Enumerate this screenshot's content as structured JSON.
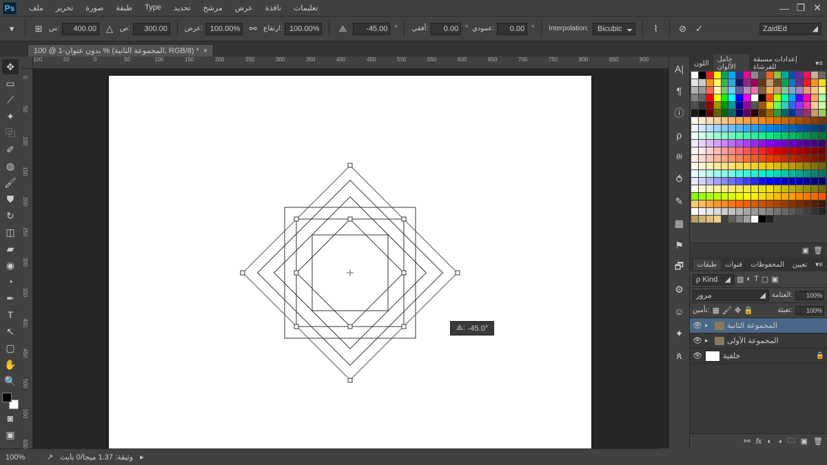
{
  "menu": [
    "ملف",
    "تحرير",
    "صورة",
    "طبقة",
    "Type",
    "تحديد",
    "مرشح",
    "عرض",
    "نافذة",
    "تعليمات"
  ],
  "optionbar": {
    "x_lbl": "س:",
    "x": "400.00",
    "y_lbl": "ص:",
    "y": "300.00",
    "w_lbl": "عرض:",
    "w": "100.00%",
    "h_lbl": "ارتفاع:",
    "h": "100.00%",
    "angle": "-45.00",
    "hskew_lbl": "أفقي:",
    "hskew": "0.00",
    "vskew_lbl": "عمودي:",
    "vskew": "0.00",
    "interp_lbl": "Interpolation:",
    "interp": "Bicubic",
    "workspace": "ZaidEd"
  },
  "doc_tab": "بدون عنوان-1 @ 100 % (المجموعة الثانية, RGB/8) *",
  "hruler_ticks": [
    "100",
    "50",
    "0",
    "50",
    "100",
    "150",
    "200",
    "250",
    "300",
    "350",
    "400",
    "450",
    "500",
    "550",
    "600",
    "650",
    "700",
    "750",
    "800",
    "850",
    "900"
  ],
  "vruler_ticks": [
    "0",
    "50",
    "100",
    "150",
    "200",
    "250",
    "300",
    "350",
    "400",
    "450",
    "500",
    "550",
    "600"
  ],
  "rotation_tooltip": "-45.0°",
  "panels": {
    "tabs_top": [
      "اللون",
      "حامل الألوان",
      "إعدادات مسبقة للفرشاة"
    ],
    "tabs_layers": [
      "طبقات",
      "قنوات",
      "المحفوظات",
      "تعيين"
    ],
    "kind": "ρ Kind",
    "blend": "مرور",
    "opacity_lbl": "العتامة:",
    "opacity": "100%",
    "fill_lbl": "تعبئة:",
    "fill": "100%",
    "lock_lbl": "تأمين:"
  },
  "layers": [
    {
      "name": "المجموعة الثانية",
      "type": "group",
      "sel": true
    },
    {
      "name": "المجموعة الأولى",
      "type": "group",
      "sel": false
    },
    {
      "name": "خلفية",
      "type": "bg",
      "sel": false
    }
  ],
  "status": {
    "zoom": "100%",
    "doc": "وثيقة: 1.37 ميجا/0 بايت"
  },
  "swatch_colors": [
    "#ffffff",
    "#000000",
    "#ec1c24",
    "#fff200",
    "#00a651",
    "#00aeef",
    "#2e3192",
    "#ec008c",
    "#898989",
    "#4d4d4d",
    "#f26522",
    "#8dc63f",
    "#00a99d",
    "#0054a6",
    "#662d91",
    "#ed145b",
    "#c7b299",
    "#736357",
    "#e6e6e6",
    "#cccccc",
    "#f7941d",
    "#fff568",
    "#39b54a",
    "#27aae1",
    "#1b1464",
    "#92278f",
    "#9e005d",
    "#603913",
    "#c49a6c",
    "#754c24",
    "#00a651",
    "#1c75bc",
    "#662d91",
    "#ed1c24",
    "#f7941d",
    "#ffde17",
    "#b3b3b3",
    "#999999",
    "#f26c4f",
    "#fff9ae",
    "#7cc576",
    "#6dcff6",
    "#605ca8",
    "#bd8cbf",
    "#f06eaa",
    "#8b5e3c",
    "#fbaf5d",
    "#c69c6d",
    "#82ca9c",
    "#7da7d9",
    "#a186be",
    "#f69679",
    "#fdc689",
    "#fff799",
    "#808080",
    "#666666",
    "#ff0000",
    "#ffff00",
    "#00ff00",
    "#00ffff",
    "#0000ff",
    "#ff00ff",
    "#ffffff",
    "#000000",
    "#ff5500",
    "#aaff00",
    "#00ffaa",
    "#00aaff",
    "#5500ff",
    "#ff00aa",
    "#ffaa55",
    "#aaffaa",
    "#4d4d4d",
    "#333333",
    "#990000",
    "#999900",
    "#009900",
    "#009999",
    "#000099",
    "#990099",
    "#555555",
    "#aa5500",
    "#ffcc00",
    "#66ff66",
    "#33cccc",
    "#3366ff",
    "#9933ff",
    "#ff3399",
    "#ffcc99",
    "#ccff99",
    "#1a1a1a",
    "#000000",
    "#660000",
    "#666600",
    "#006600",
    "#006666",
    "#000066",
    "#660066",
    "#330000",
    "#663300",
    "#996600",
    "#339933",
    "#006666",
    "#003399",
    "#663399",
    "#993366",
    "#cc9966",
    "#99cc66",
    "#fef4e8",
    "#fde9d0",
    "#fcdcb7",
    "#fad09f",
    "#f9c487",
    "#f7b870",
    "#f5ac59",
    "#f39f43",
    "#f1932e",
    "#ef871a",
    "#ed7b08",
    "#dc7000",
    "#cb6600",
    "#ba5c00",
    "#a95200",
    "#984800",
    "#873e00",
    "#763400",
    "#e8f4fe",
    "#d0e9fd",
    "#b8defc",
    "#a0d3fa",
    "#88c8f9",
    "#70bdf7",
    "#58b2f5",
    "#40a7f3",
    "#289cf1",
    "#1091ef",
    "#0086ed",
    "#007bdc",
    "#0070cb",
    "#0065ba",
    "#005aa9",
    "#004f98",
    "#004487",
    "#003976",
    "#e8fef4",
    "#d0fde9",
    "#b8fcde",
    "#a0fad3",
    "#88f9c8",
    "#70f7bd",
    "#58f5b2",
    "#40f3a7",
    "#28f19c",
    "#10ef91",
    "#00ed86",
    "#00dc7b",
    "#00cb70",
    "#00ba65",
    "#00a95a",
    "#00984f",
    "#008744",
    "#007639",
    "#f4e8fe",
    "#e9d0fd",
    "#deb8fc",
    "#d3a0fa",
    "#c888f9",
    "#bd70f7",
    "#b258f5",
    "#a740f3",
    "#9c28f1",
    "#9110ef",
    "#8600ed",
    "#7b00dc",
    "#7000cb",
    "#6500ba",
    "#5a00a9",
    "#4f0098",
    "#440087",
    "#390076",
    "#fef4f4",
    "#fde9e9",
    "#fcd0d0",
    "#fab8b8",
    "#f9a0a0",
    "#f78888",
    "#f57070",
    "#f35858",
    "#f14040",
    "#ef2828",
    "#ed1010",
    "#dc0000",
    "#cb0000",
    "#ba0000",
    "#a90000",
    "#980000",
    "#870000",
    "#760000",
    "#feeee8",
    "#fddcd0",
    "#fccab8",
    "#fab8a0",
    "#f9a688",
    "#f79470",
    "#f58258",
    "#f37040",
    "#f15e28",
    "#ef4c10",
    "#ed3a00",
    "#dc3400",
    "#cb2e00",
    "#ba2800",
    "#a92200",
    "#981c00",
    "#871600",
    "#761000",
    "#fefae8",
    "#fdf5d0",
    "#fcf0b8",
    "#faeba0",
    "#f9e688",
    "#f7e170",
    "#f5dc58",
    "#f3d740",
    "#f1d228",
    "#efcd10",
    "#edc800",
    "#dcba00",
    "#cbac00",
    "#ba9e00",
    "#a99000",
    "#988200",
    "#877400",
    "#766600",
    "#e8fefa",
    "#d0fdf5",
    "#b8fcf0",
    "#a0faeb",
    "#88f9e6",
    "#70f7e1",
    "#58f5dc",
    "#40f3d7",
    "#28f1d2",
    "#10efcd",
    "#00edc8",
    "#00dcba",
    "#00cbac",
    "#00ba9e",
    "#00a990",
    "#009882",
    "#008774",
    "#007666",
    "#e8e8fe",
    "#d0d0fd",
    "#b8b8fc",
    "#a0a0fa",
    "#8888f9",
    "#7070f7",
    "#5858f5",
    "#4040f3",
    "#2828f1",
    "#1010ef",
    "#0000ed",
    "#0000dc",
    "#0000cb",
    "#0000ba",
    "#0000a9",
    "#000098",
    "#000087",
    "#000076",
    "#fefce8",
    "#fdf9d0",
    "#fcf6b8",
    "#faf3a0",
    "#f9f088",
    "#f7ed70",
    "#f5ea58",
    "#f3e740",
    "#f1e428",
    "#efe110",
    "#edde00",
    "#dcce00",
    "#cbbe00",
    "#baae00",
    "#a99e00",
    "#988e00",
    "#877e00",
    "#766e00",
    "#88ff00",
    "#99ff00",
    "#aaff00",
    "#bbff00",
    "#ccff00",
    "#ddff00",
    "#eeff00",
    "#ffff00",
    "#ffee00",
    "#ffdd00",
    "#ffcc00",
    "#ffbb00",
    "#ffaa00",
    "#ff9900",
    "#ff8800",
    "#ff7700",
    "#ff6600",
    "#ff5500",
    "#ffcc66",
    "#ffbb55",
    "#ffaa44",
    "#ff9933",
    "#ff8822",
    "#ff7711",
    "#ff6600",
    "#ee5f00",
    "#dd5800",
    "#cc5100",
    "#bb4a00",
    "#aa4300",
    "#993c00",
    "#883500",
    "#772e00",
    "#662700",
    "#552000",
    "#441900",
    "#ffffff",
    "#f2f2f2",
    "#e6e6e6",
    "#d9d9d9",
    "#cccccc",
    "#bfbfbf",
    "#b3b3b3",
    "#a6a6a6",
    "#999999",
    "#8c8c8c",
    "#808080",
    "#737373",
    "#666666",
    "#595959",
    "#4d4d4d",
    "#404040",
    "#333333",
    "#262626",
    "#c0a060",
    "#d0b070",
    "#e0c080",
    "#f0d090",
    "#404040",
    "#606060",
    "#808080",
    "#a0a0a0",
    "#ffffff",
    "#000000",
    "#202020",
    "#",
    "#",
    "#",
    "#",
    "#",
    "#",
    "#"
  ]
}
